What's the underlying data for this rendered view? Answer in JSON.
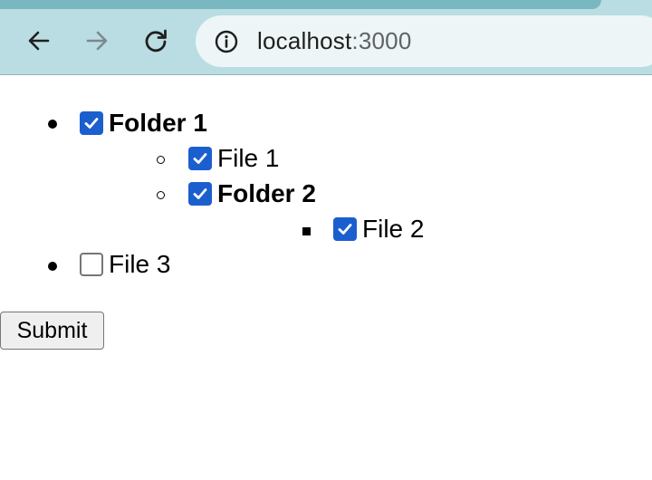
{
  "browser": {
    "url_host": "localhost",
    "url_port": ":3000"
  },
  "tree": {
    "folder1": {
      "label": "Folder 1",
      "checked": true
    },
    "file1": {
      "label": "File 1",
      "checked": true
    },
    "folder2": {
      "label": "Folder 2",
      "checked": true
    },
    "file2": {
      "label": "File 2",
      "checked": true
    },
    "file3": {
      "label": "File 3",
      "checked": false
    }
  },
  "form": {
    "submit_label": "Submit"
  },
  "colors": {
    "checkbox_checked": "#1b5fcf",
    "toolbar_bg": "#b9dde2",
    "omnibox_bg": "#edf5f6"
  },
  "icons": [
    "back-arrow-icon",
    "forward-arrow-icon",
    "reload-icon",
    "info-icon",
    "checkmark-icon"
  ]
}
